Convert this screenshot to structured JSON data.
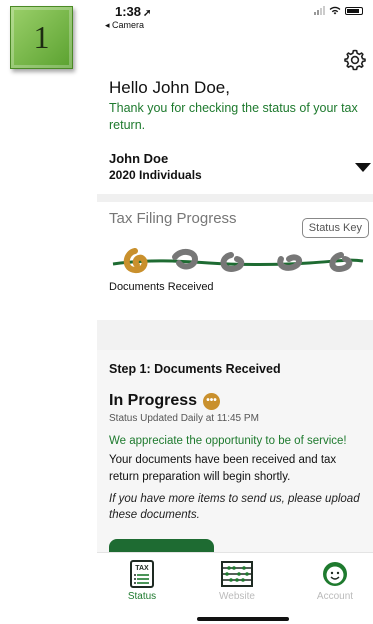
{
  "slide_badge": "1",
  "statusbar": {
    "time": "1:38",
    "back_app": "◂ Camera"
  },
  "greeting": {
    "hello": "Hello John Doe,",
    "message": "Thank you for checking the status of your tax return."
  },
  "account": {
    "name": "John Doe",
    "subtitle": "2020 Individuals"
  },
  "progress": {
    "title": "Tax Filing Progress",
    "status_key_label": "Status Key",
    "current_stage": "Documents Received",
    "stages_total": 5,
    "stages_active": 1,
    "colors": {
      "active": "#c9902d",
      "inactive": "#777777",
      "line": "#1e6b32"
    }
  },
  "step": {
    "title": "Step 1: Documents Received",
    "state": "In Progress",
    "updated": "Status Updated Daily at 11:45 PM",
    "appreciate": "We appreciate the opportunity to be of service!",
    "documents": "Your documents have been received and tax return preparation will begin shortly.",
    "upload": "If you have more items to send us, please upload these documents."
  },
  "tabs": [
    {
      "label": "Status",
      "icon": "tax-form-icon",
      "active": true
    },
    {
      "label": "Website",
      "icon": "abacus-icon",
      "active": false
    },
    {
      "label": "Account",
      "icon": "face-icon",
      "active": false
    }
  ],
  "colors": {
    "brand_green": "#1e7a2e",
    "accent_gold": "#c9902d"
  }
}
